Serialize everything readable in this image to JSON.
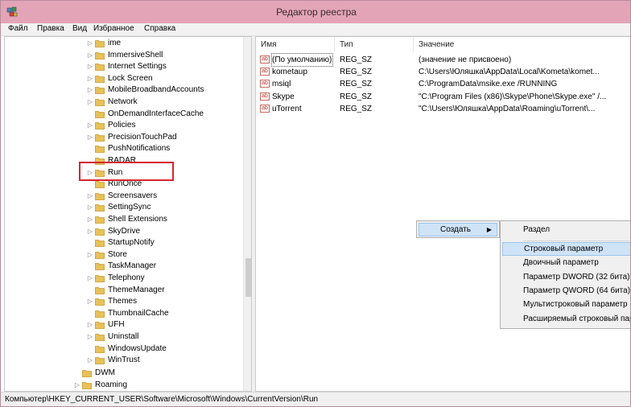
{
  "window": {
    "title": "Редактор реестра"
  },
  "menu": [
    "Файл",
    "Правка",
    "Вид",
    "Избранное",
    "Справка"
  ],
  "tree": {
    "items": [
      {
        "label": "ime",
        "expander": "▷"
      },
      {
        "label": "ImmersiveShell",
        "expander": "▷"
      },
      {
        "label": "Internet Settings",
        "expander": "▷"
      },
      {
        "label": "Lock Screen",
        "expander": "▷"
      },
      {
        "label": "MobileBroadbandAccounts",
        "expander": "▷"
      },
      {
        "label": "Network",
        "expander": "▷"
      },
      {
        "label": "OnDemandInterfaceCache",
        "expander": ""
      },
      {
        "label": "Policies",
        "expander": "▷"
      },
      {
        "label": "PrecisionTouchPad",
        "expander": "▷"
      },
      {
        "label": "PushNotifications",
        "expander": ""
      },
      {
        "label": "RADAR",
        "expander": ""
      },
      {
        "label": "Run",
        "expander": "▷"
      },
      {
        "label": "RunOnce",
        "expander": ""
      },
      {
        "label": "Screensavers",
        "expander": "▷"
      },
      {
        "label": "SettingSync",
        "expander": "▷"
      },
      {
        "label": "Shell Extensions",
        "expander": "▷"
      },
      {
        "label": "SkyDrive",
        "expander": "▷"
      },
      {
        "label": "StartupNotify",
        "expander": ""
      },
      {
        "label": "Store",
        "expander": "▷"
      },
      {
        "label": "TaskManager",
        "expander": ""
      },
      {
        "label": "Telephony",
        "expander": "▷"
      },
      {
        "label": "ThemeManager",
        "expander": ""
      },
      {
        "label": "Themes",
        "expander": "▷"
      },
      {
        "label": "ThumbnailCache",
        "expander": ""
      },
      {
        "label": "UFH",
        "expander": "▷"
      },
      {
        "label": "Uninstall",
        "expander": "▷"
      },
      {
        "label": "WindowsUpdate",
        "expander": ""
      },
      {
        "label": "WinTrust",
        "expander": "▷"
      }
    ],
    "parent_items": [
      {
        "label": "DWM",
        "expander": ""
      },
      {
        "label": "Roaming",
        "expander": "▷"
      }
    ]
  },
  "list": {
    "columns": [
      "Имя",
      "Тип",
      "Значение"
    ],
    "rows": [
      {
        "name": "(По умолчанию)",
        "type": "REG_SZ",
        "value": "(значение не присвоено)"
      },
      {
        "name": "kometaup",
        "type": "REG_SZ",
        "value": "C:\\Users\\Юляшка\\AppData\\Local\\Kometa\\komet..."
      },
      {
        "name": "msiql",
        "type": "REG_SZ",
        "value": "C:\\ProgramData\\msike.exe /RUNNING"
      },
      {
        "name": "Skype",
        "type": "REG_SZ",
        "value": "\"C:\\Program Files (x86)\\Skype\\Phone\\Skype.exe\" /..."
      },
      {
        "name": "uTorrent",
        "type": "REG_SZ",
        "value": "\"C:\\Users\\Юляшка\\AppData\\Roaming\\uTorrent\\..."
      }
    ],
    "value_icon": "ab"
  },
  "context_menu": {
    "label": "Создать",
    "arrow": "▶"
  },
  "submenu": {
    "items": [
      "Раздел",
      "Строковый параметр",
      "Двоичный параметр",
      "Параметр DWORD (32 бита)",
      "Параметр QWORD (64 бита)",
      "Мультистроковый параметр",
      "Расширяемый строковый пар"
    ],
    "highlighted_index": 1
  },
  "status": {
    "path": "Компьютер\\HKEY_CURRENT_USER\\Software\\Microsoft\\Windows\\CurrentVersion\\Run"
  },
  "colors": {
    "titlebar": "#e3a4b8",
    "highlight_border": "#d6262f",
    "selection": "#cfe3f7",
    "folder": "#e8c15a"
  }
}
